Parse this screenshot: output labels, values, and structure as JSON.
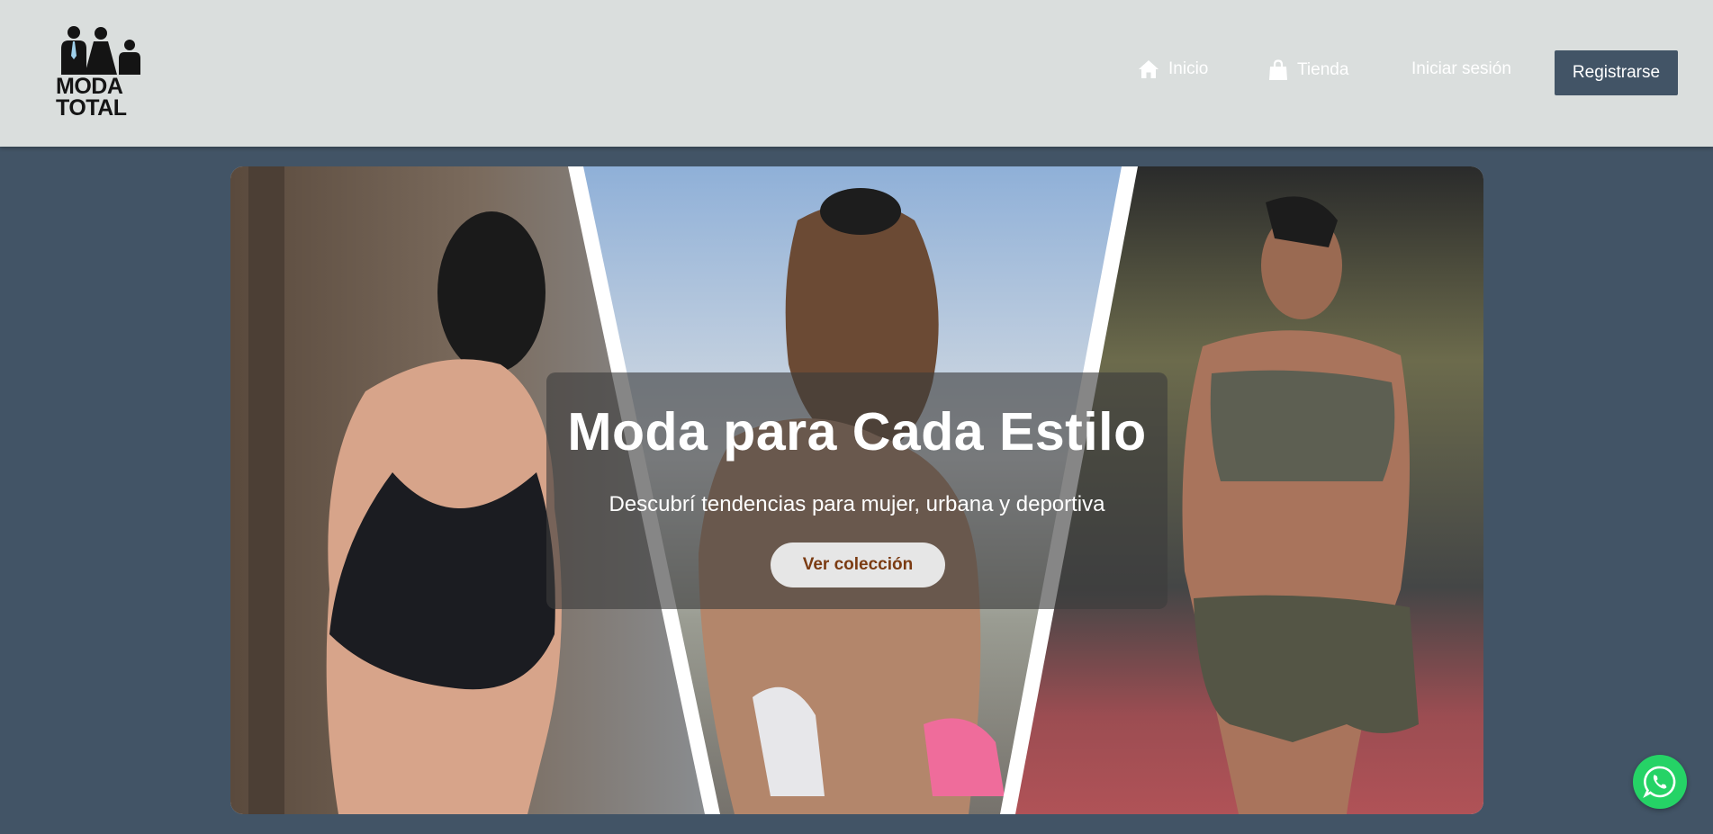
{
  "brand": {
    "line1": "MODA",
    "line2": "TOTAL"
  },
  "nav": {
    "home_label": "Inicio",
    "home_icon": "home-icon",
    "shop_label": "Tienda",
    "shop_icon": "shopping-bag-icon",
    "login_label": "Iniciar sesión",
    "register_label": "Registrarse"
  },
  "hero": {
    "title": "Moda para Cada Estilo",
    "subtitle": "Descubrí tendencias para mujer, urbana y deportiva",
    "cta_label": "Ver colección"
  },
  "floating": {
    "whatsapp_icon": "whatsapp-icon"
  },
  "colors": {
    "navbar_bg": "#dadedd",
    "page_bg": "#425466",
    "register_bg": "#425466",
    "cta_text": "#7b3b12",
    "whatsapp": "#25d366"
  }
}
